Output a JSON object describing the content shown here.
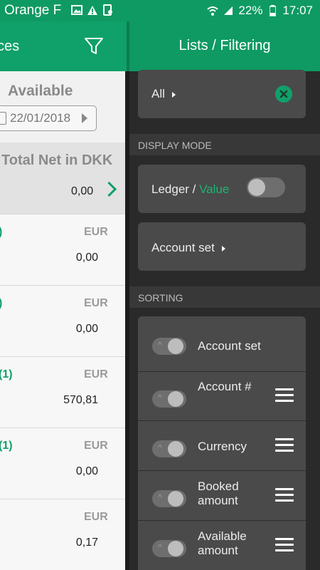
{
  "status_bar": {
    "carrier": "Orange F",
    "battery": "22%",
    "time": "17:07"
  },
  "left": {
    "title": "ces",
    "available_label": "Available",
    "date": "22/01/2018",
    "total_label": "Total Net in DKK",
    "total_value": "0,00",
    "rows": [
      {
        "count": ")",
        "currency": "EUR",
        "value": "0,00"
      },
      {
        "count": ")",
        "currency": "EUR",
        "value": "0,00"
      },
      {
        "count": "(1)",
        "currency": "EUR",
        "value": "570,81"
      },
      {
        "count": "(1)",
        "currency": "EUR",
        "value": "0,00"
      },
      {
        "count": "",
        "currency": "EUR",
        "value": "0,17"
      }
    ]
  },
  "drawer": {
    "title": "Lists / Filtering",
    "filter_all": "All",
    "display_mode_label": "DISPLAY MODE",
    "ledger_label": "Ledger / ",
    "value_label": "Value",
    "account_set_label": "Account set",
    "sorting_label": "SORTING",
    "sort_items": [
      "Account set",
      "Account #",
      "Currency",
      "Booked amount",
      "Available amount"
    ]
  },
  "colors": {
    "accent": "#0f9a63",
    "panel": "#4a4a4a"
  }
}
